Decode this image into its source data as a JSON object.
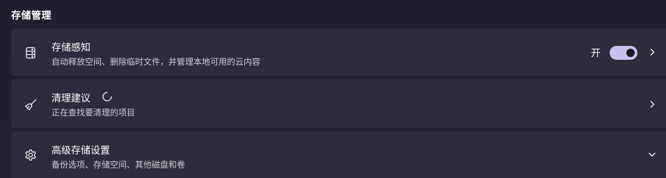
{
  "section": {
    "title": "存储管理"
  },
  "colors": {
    "background": "#1f1e2c",
    "card": "#2c2c3a",
    "accent": "#c7c2ee",
    "text_secondary": "#cfcfd6"
  },
  "items": [
    {
      "icon": "storage-drive-icon",
      "title": "存储感知",
      "description": "自动释放空间、删除临时文件，并管理本地可用的云内容",
      "toggle": {
        "label": "开",
        "state": true
      },
      "trailing_icon": "chevron-right-icon"
    },
    {
      "icon": "broom-icon",
      "title": "清理建议",
      "description": "正在查找要清理的项目",
      "loading": true,
      "trailing_icon": "chevron-right-icon"
    },
    {
      "icon": "gear-icon",
      "title": "高级存储设置",
      "description": "备份选项、存储空间、其他磁盘和卷",
      "trailing_icon": "chevron-down-icon"
    }
  ]
}
